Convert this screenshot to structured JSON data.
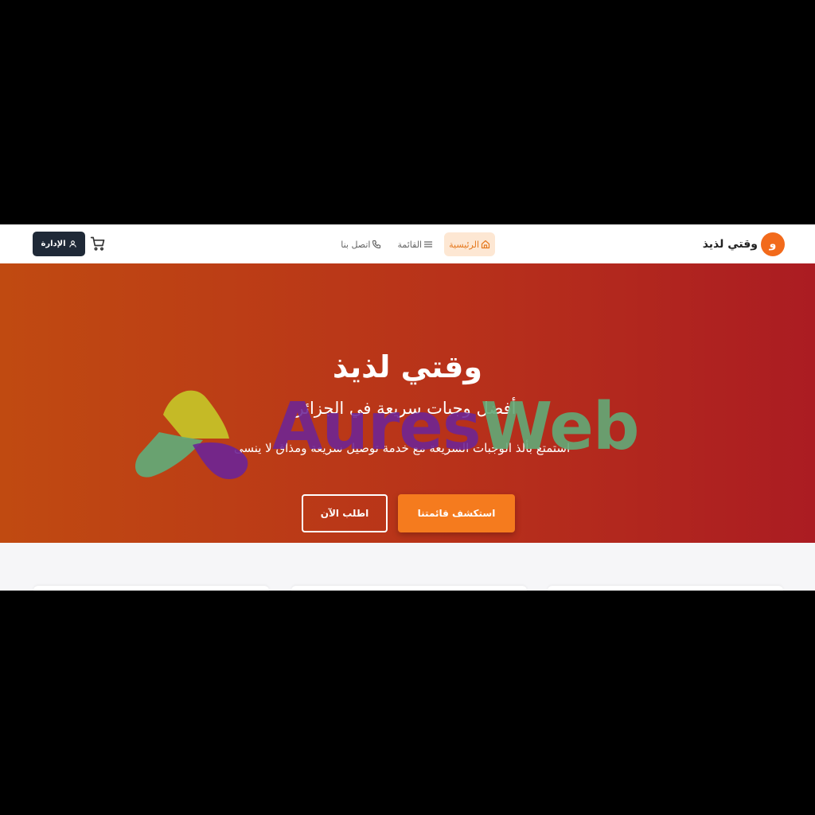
{
  "navbar": {
    "brand_logo_letter": "و",
    "brand_name": "وقتي لذيذ",
    "nav_items": [
      {
        "label": "الرئيسية",
        "icon": "home-icon",
        "active": true
      },
      {
        "label": "القائمة",
        "icon": "menu-icon",
        "active": false
      },
      {
        "label": "اتصل بنا",
        "icon": "phone-icon",
        "active": false
      }
    ],
    "cart_icon": "cart-icon",
    "admin_label": "الإدارة",
    "admin_icon": "user-icon"
  },
  "hero": {
    "title": "وقتي لذيذ",
    "subtitle": "أفضل وجبات سريعة في الجزائر",
    "description": "استمتع بألذ الوجبات السريعة مع خدمة توصيل سريعة ومذاق لا ينسى",
    "primary_button": "استكشف قائمتنا",
    "secondary_button": "اطلب الآن"
  },
  "watermark": {
    "part1": "Aures",
    "part2": "Web"
  },
  "colors": {
    "accent": "#f57b1e",
    "hero_start": "#c04a11",
    "hero_end": "#ab1c22",
    "admin_bg": "#1f2937"
  }
}
